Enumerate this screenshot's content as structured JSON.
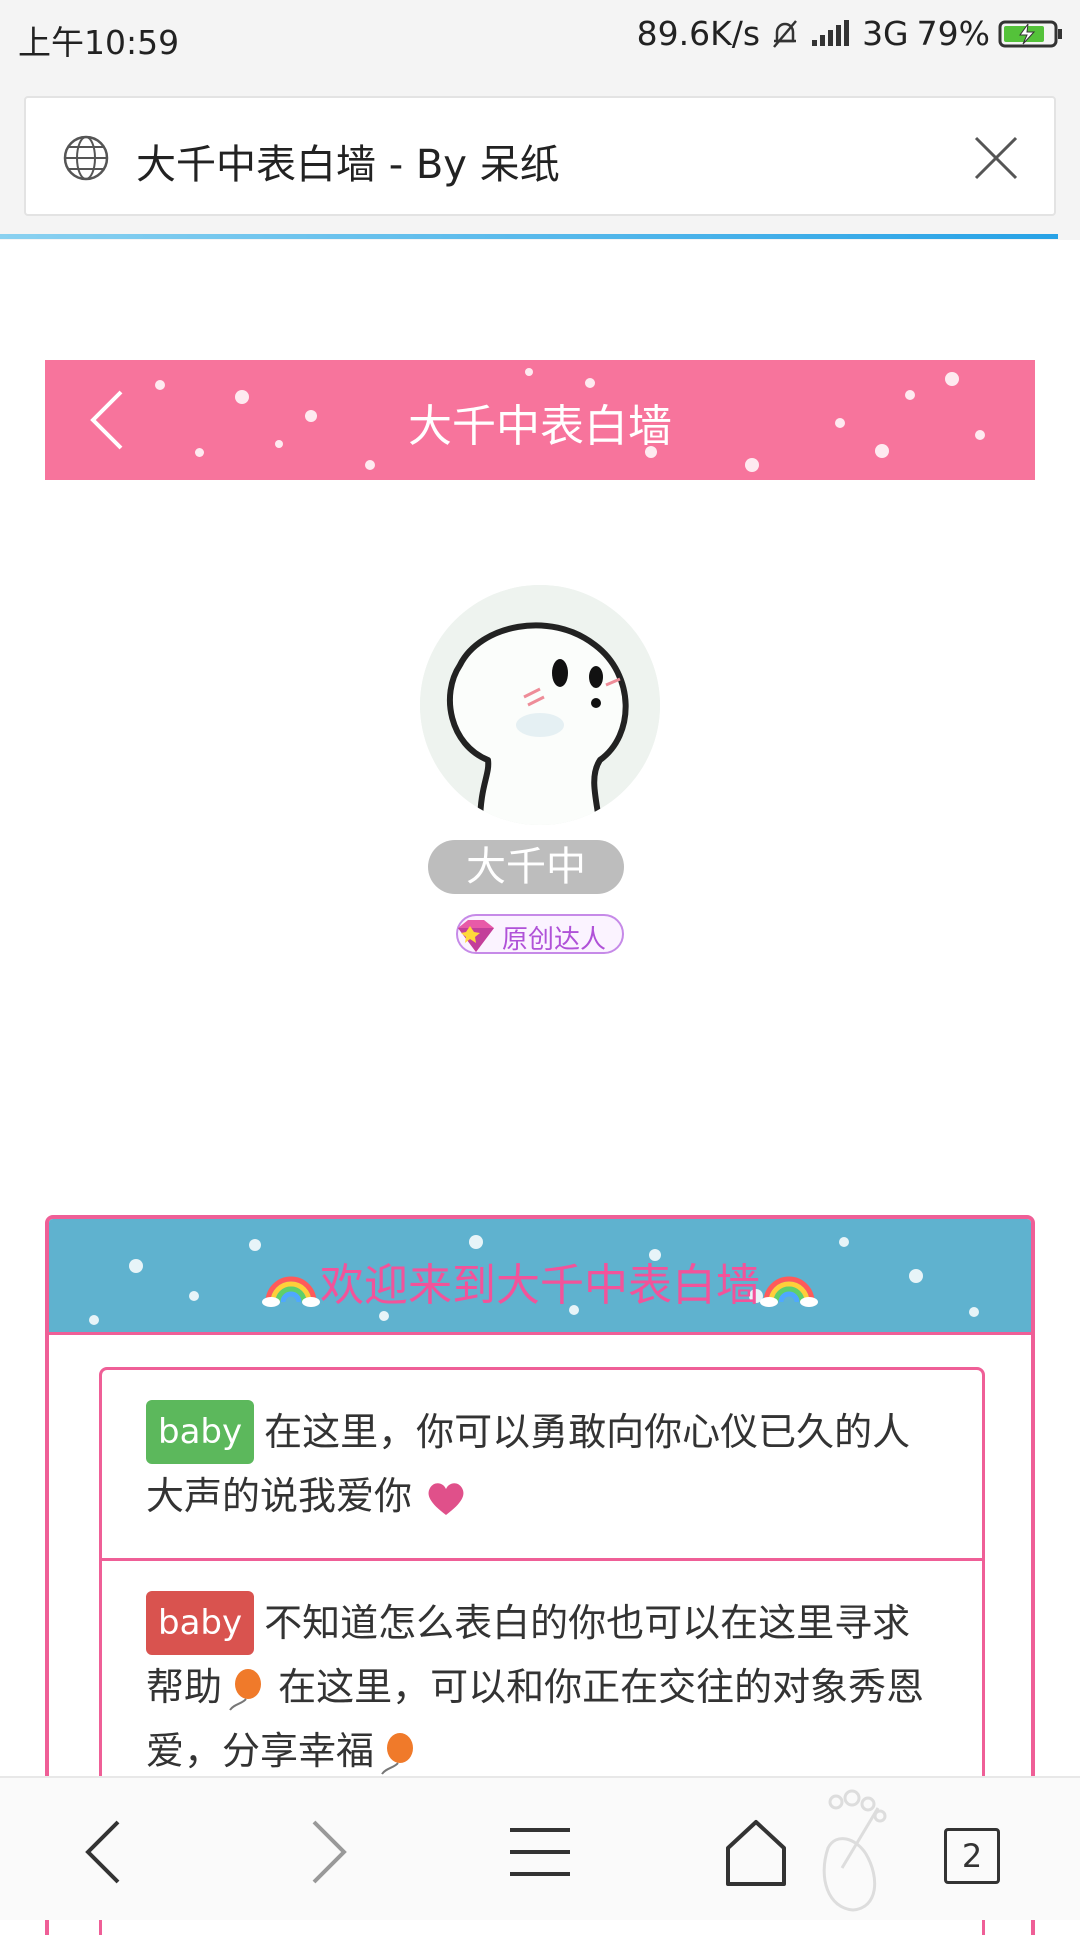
{
  "status_bar": {
    "time": "上午10:59",
    "speed": "89.6K/s",
    "network": "3G",
    "battery": "79%"
  },
  "url_bar": {
    "page_title": "大千中表白墙 - By 呆纸",
    "globe_icon": "globe-icon",
    "close_icon": "close-icon"
  },
  "header": {
    "title": "大千中表白墙",
    "back_icon": "chevron-left-icon"
  },
  "profile": {
    "name": "大千中",
    "badge": "原创达人"
  },
  "welcome": {
    "title": "欢迎来到大千中表白墙",
    "messages": [
      {
        "tag": "baby",
        "text": "在这里，你可以勇敢向你心仪已久的人大声的说我爱你"
      },
      {
        "tag": "baby",
        "text_a": "不知道怎么表白的你也可以在这里寻求帮助",
        "text_b": " 在这里，可以和你正在交往的对象秀恩爱，分享幸福"
      }
    ]
  },
  "bottom_nav": {
    "tab_count": "2"
  },
  "colors": {
    "pink": "#f7749c",
    "card_border": "#ef5f97",
    "welcome_bg": "#5fb2cf",
    "welcome_text": "#f2539a",
    "tag_green": "#5cb85c",
    "tag_red": "#d9534f"
  }
}
